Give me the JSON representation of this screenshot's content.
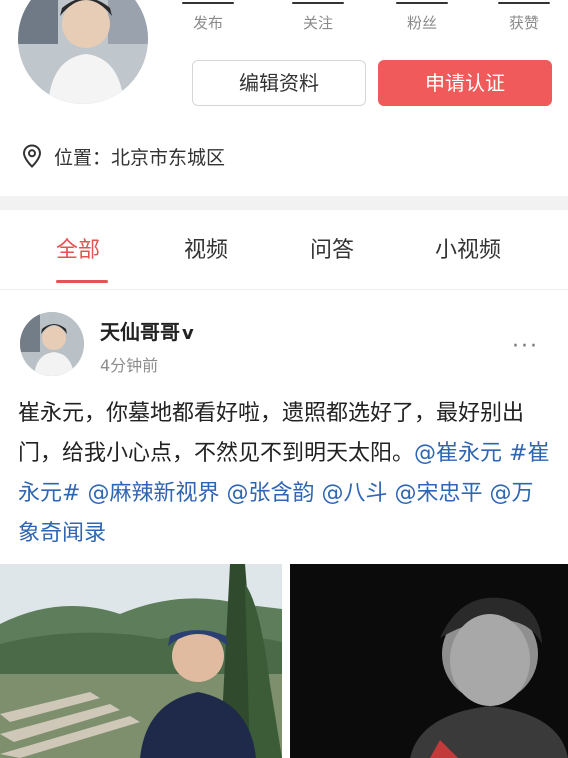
{
  "profile": {
    "stats": [
      {
        "label": "发布"
      },
      {
        "label": "关注"
      },
      {
        "label": "粉丝"
      },
      {
        "label": "获赞"
      }
    ],
    "edit_button": "编辑资料",
    "verify_button": "申请认证",
    "location": "位置：北京市东城区"
  },
  "tabs": [
    {
      "label": "全部",
      "active": true
    },
    {
      "label": "视频",
      "active": false
    },
    {
      "label": "问答",
      "active": false
    },
    {
      "label": "小视频",
      "active": false
    }
  ],
  "post": {
    "author": "天仙哥哥",
    "verified_badge": "v",
    "time": "4分钟前",
    "more": "···",
    "text_plain": "崔永元，你墓地都看好啦，遗照都选好了，最好别出门，给我小心点，不然见不到明天太阳。",
    "mentions": [
      "@崔永元",
      "#崔永元#",
      "@麻辣新视界",
      "@张含韵",
      "@八斗",
      "@宋忠平",
      "@万象奇闻录"
    ]
  },
  "colors": {
    "accent": "#e55252",
    "verify_bg": "#f05a5a",
    "link": "#2f66b3"
  }
}
